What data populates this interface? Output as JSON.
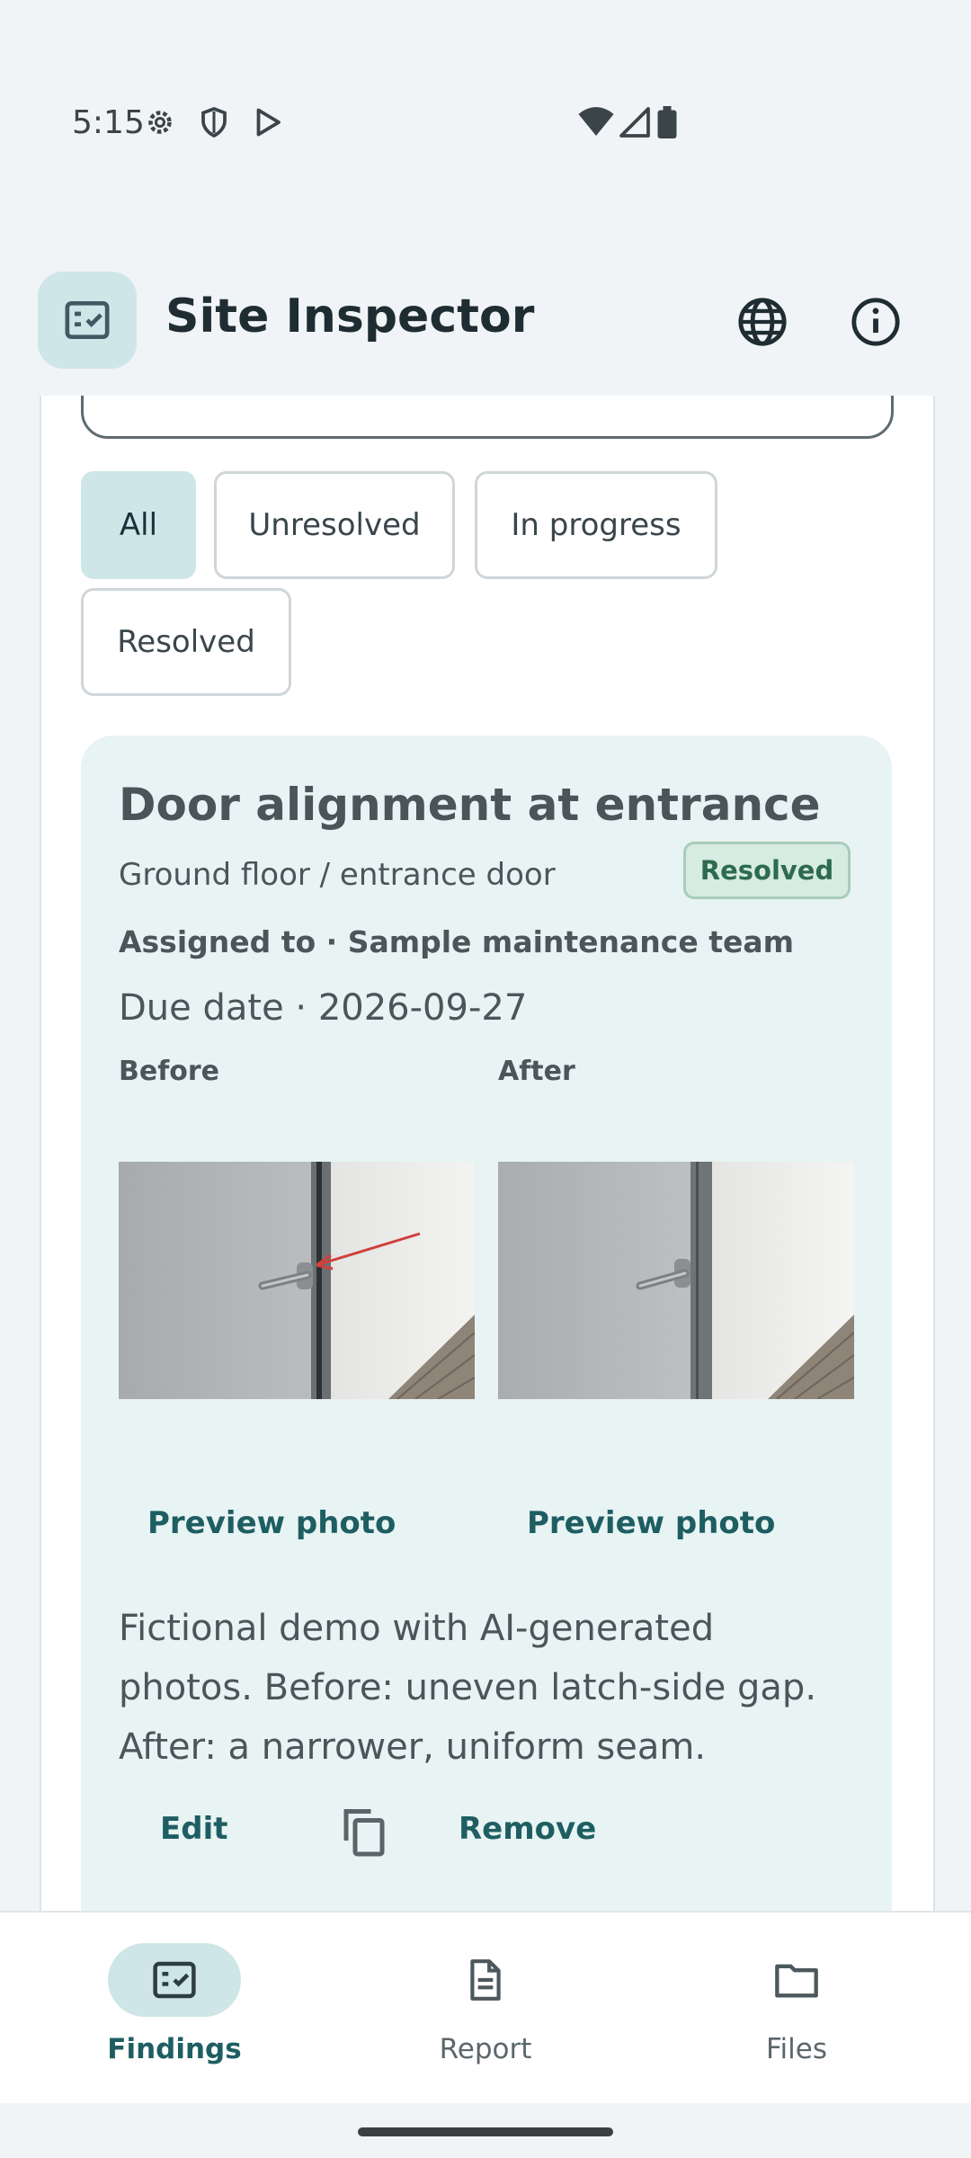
{
  "status_bar": {
    "time": "5:15"
  },
  "app_bar": {
    "title": "Site Inspector"
  },
  "filters": {
    "chips": [
      {
        "label": "All"
      },
      {
        "label": "Unresolved"
      },
      {
        "label": "In progress"
      },
      {
        "label": "Resolved"
      }
    ],
    "selected": "All"
  },
  "finding": {
    "title": "Door alignment at entrance",
    "location": "Ground floor / entrance door",
    "status": "Resolved",
    "assigned": "Assigned to · Sample maintenance team",
    "due": "Due date · 2026-09-27",
    "before_label": "Before",
    "after_label": "After",
    "preview_label": "Preview photo",
    "description": "Fictional demo with AI-generated photos. Before: uneven latch-side gap. After: a narrower, uniform seam.",
    "edit_label": "Edit",
    "remove_label": "Remove"
  },
  "bottom_nav": {
    "items": [
      {
        "label": "Findings",
        "icon": "findings-icon",
        "active": true
      },
      {
        "label": "Report",
        "icon": "report-icon",
        "active": false
      },
      {
        "label": "Files",
        "icon": "folder-icon",
        "active": false
      }
    ]
  },
  "colors": {
    "accent": "#1e5e62",
    "selected_chip": "#cfe6e8",
    "card_background": "#e8f3f3",
    "resolved_badge": "#d6ebe2"
  }
}
